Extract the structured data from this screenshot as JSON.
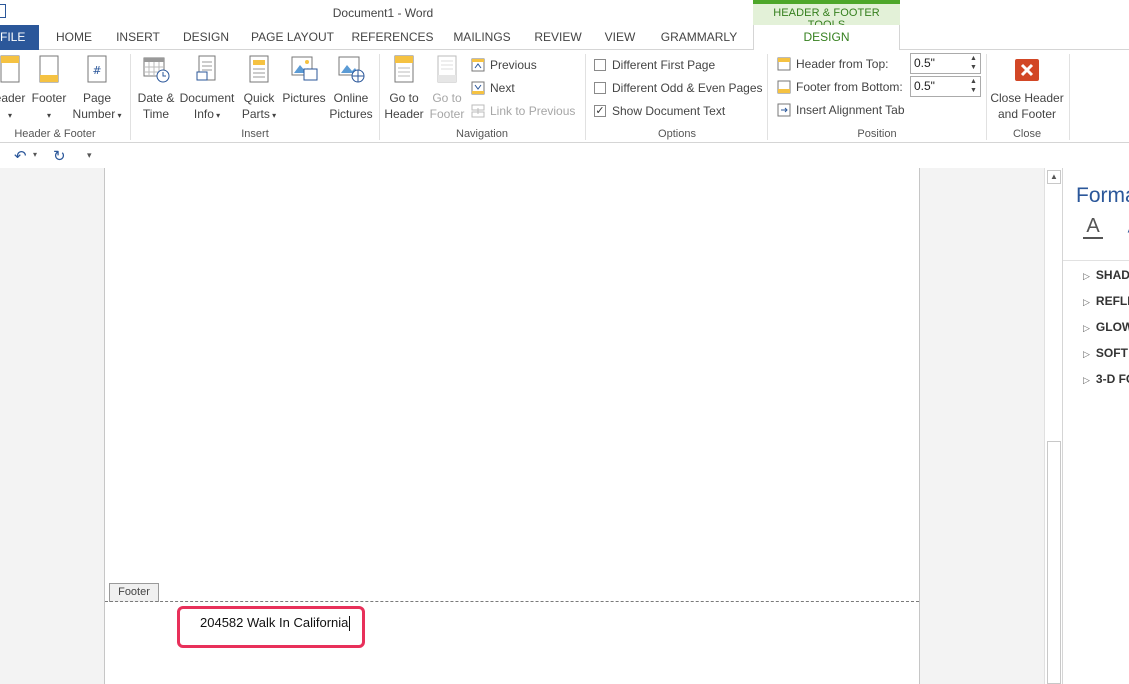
{
  "window": {
    "title": "Document1 - Word",
    "contextual_header": "HEADER & FOOTER TOOLS"
  },
  "tabs": [
    {
      "label": "FILE"
    },
    {
      "label": "HOME"
    },
    {
      "label": "INSERT"
    },
    {
      "label": "DESIGN"
    },
    {
      "label": "PAGE LAYOUT"
    },
    {
      "label": "REFERENCES"
    },
    {
      "label": "MAILINGS"
    },
    {
      "label": "REVIEW"
    },
    {
      "label": "VIEW"
    },
    {
      "label": "GRAMMARLY"
    },
    {
      "label": "DESIGN"
    }
  ],
  "ribbon": {
    "header_footer": {
      "group_label": "Header & Footer",
      "header_label": "eader",
      "footer_label": "Footer",
      "page_number_line1": "Page",
      "page_number_line2": "Number"
    },
    "insert": {
      "group_label": "Insert",
      "date_time_line1": "Date &",
      "date_time_line2": "Time",
      "doc_info_line1": "Document",
      "doc_info_line2": "Info",
      "quick_parts_line1": "Quick",
      "quick_parts_line2": "Parts",
      "pictures": "Pictures",
      "online_pictures_line1": "Online",
      "online_pictures_line2": "Pictures"
    },
    "navigation": {
      "group_label": "Navigation",
      "go_to_header_line1": "Go to",
      "go_to_header_line2": "Header",
      "go_to_footer_line1": "Go to",
      "go_to_footer_line2": "Footer",
      "previous": "Previous",
      "next": "Next",
      "link_to_previous": "Link to Previous"
    },
    "options": {
      "group_label": "Options",
      "different_first_page": "Different First Page",
      "different_first_page_checked": false,
      "different_odd_even": "Different Odd & Even Pages",
      "different_odd_even_checked": false,
      "show_document_text": "Show Document Text",
      "show_document_text_checked": true
    },
    "position": {
      "group_label": "Position",
      "header_from_top_label": "Header from Top:",
      "header_from_top_value": "0.5\"",
      "footer_from_bottom_label": "Footer from Bottom:",
      "footer_from_bottom_value": "0.5\"",
      "insert_alignment_tab": "Insert Alignment Tab"
    },
    "close": {
      "group_label": "Close",
      "close_line1": "Close Header",
      "close_line2": "and Footer"
    }
  },
  "document": {
    "footer_tag": "Footer",
    "footer_text": "204582 Walk In California"
  },
  "task_pane": {
    "title": "Format",
    "sections": [
      "SHAD",
      "REFLE",
      "GLOW",
      "SOFT",
      "3-D FO"
    ]
  },
  "colors": {
    "brand_blue": "#2b579a",
    "contextual_green": "#36801f",
    "highlight_pink": "#e8305a"
  }
}
